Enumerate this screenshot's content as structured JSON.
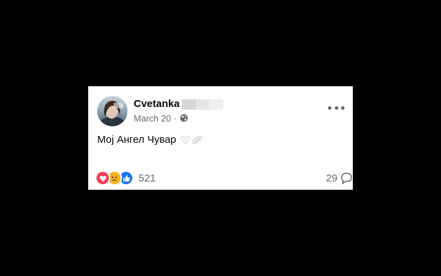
{
  "post": {
    "author": "Cvetanka",
    "date": "March 20",
    "separator": "·",
    "text": "Мој Ангел Чувар",
    "emojis": [
      "white-heart-icon",
      "wing-icon"
    ],
    "reactions": {
      "types": [
        "love-icon",
        "sad-icon",
        "like-icon"
      ],
      "count": "521"
    },
    "comments_count": "29"
  },
  "colors": {
    "background": "#000000",
    "card": "#ffffff",
    "secondary_text": "#65676b",
    "love": "#f33e58",
    "sad": "#f7b125",
    "like": "#1877f2"
  }
}
